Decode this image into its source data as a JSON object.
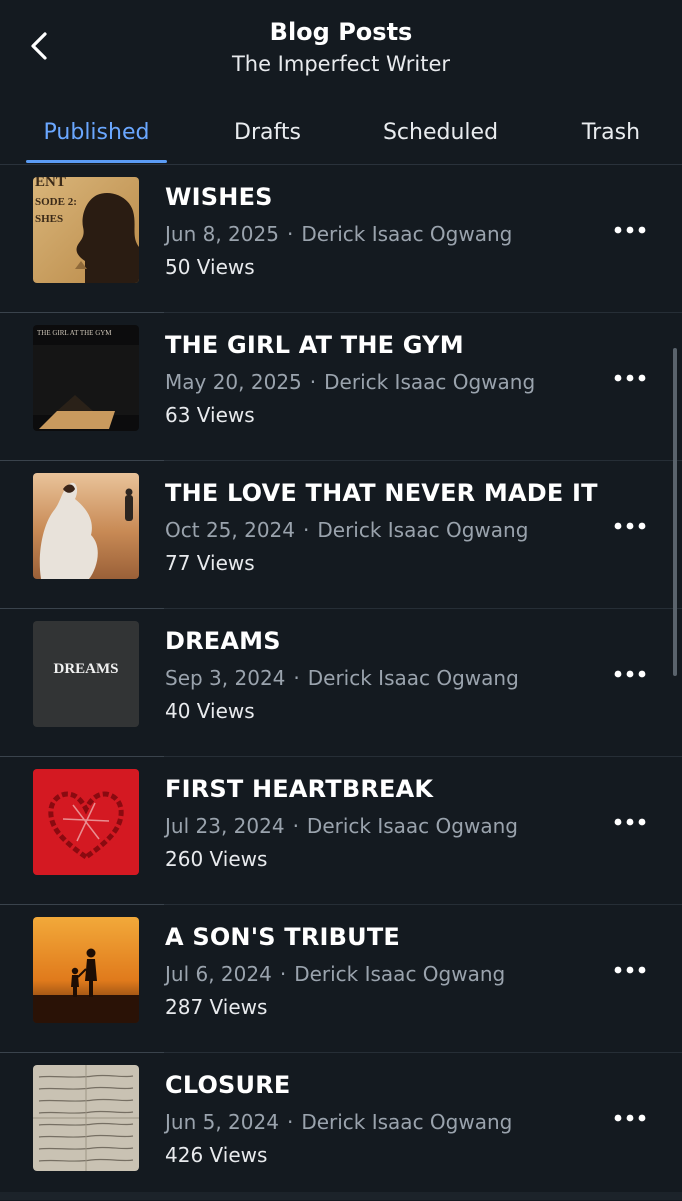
{
  "header": {
    "title": "Blog Posts",
    "subtitle": "The Imperfect Writer",
    "back_icon": "chevron-left-icon"
  },
  "tabs": [
    {
      "label": "Published",
      "active": true
    },
    {
      "label": "Drafts",
      "active": false
    },
    {
      "label": "Scheduled",
      "active": false
    },
    {
      "label": "Trash",
      "active": false
    }
  ],
  "colors": {
    "background": "#141a20",
    "accent": "#6aa7ff",
    "meta_text": "#9aa3ad"
  },
  "posts": [
    {
      "title": "WISHES",
      "date": "Jun 8, 2025",
      "author": "Derick Isaac Ogwang",
      "views": "50 Views",
      "thumb_text_top": "ENT",
      "thumb_text_mid": "SODE 2:",
      "thumb_text_bot": "SHES"
    },
    {
      "title": "THE GIRL AT THE GYM",
      "date": "May 20, 2025",
      "author": "Derick Isaac Ogwang",
      "views": "63 Views",
      "thumb_text": "THE GIRL AT THE GYM"
    },
    {
      "title": "THE LOVE THAT NEVER MADE IT",
      "date": "Oct 25, 2024",
      "author": "Derick Isaac Ogwang",
      "views": "77 Views"
    },
    {
      "title": "DREAMS",
      "date": "Sep 3, 2024",
      "author": "Derick Isaac Ogwang",
      "views": "40 Views",
      "thumb_text": "DREAMS"
    },
    {
      "title": "FIRST HEARTBREAK",
      "date": "Jul 23, 2024",
      "author": "Derick Isaac Ogwang",
      "views": "260 Views"
    },
    {
      "title": "A SON'S TRIBUTE",
      "date": "Jul 6, 2024",
      "author": "Derick Isaac Ogwang",
      "views": "287 Views"
    },
    {
      "title": "CLOSURE",
      "date": "Jun 5, 2024",
      "author": "Derick Isaac Ogwang",
      "views": "426 Views"
    }
  ],
  "row_actions": {
    "more_icon": "more-horizontal-icon"
  }
}
